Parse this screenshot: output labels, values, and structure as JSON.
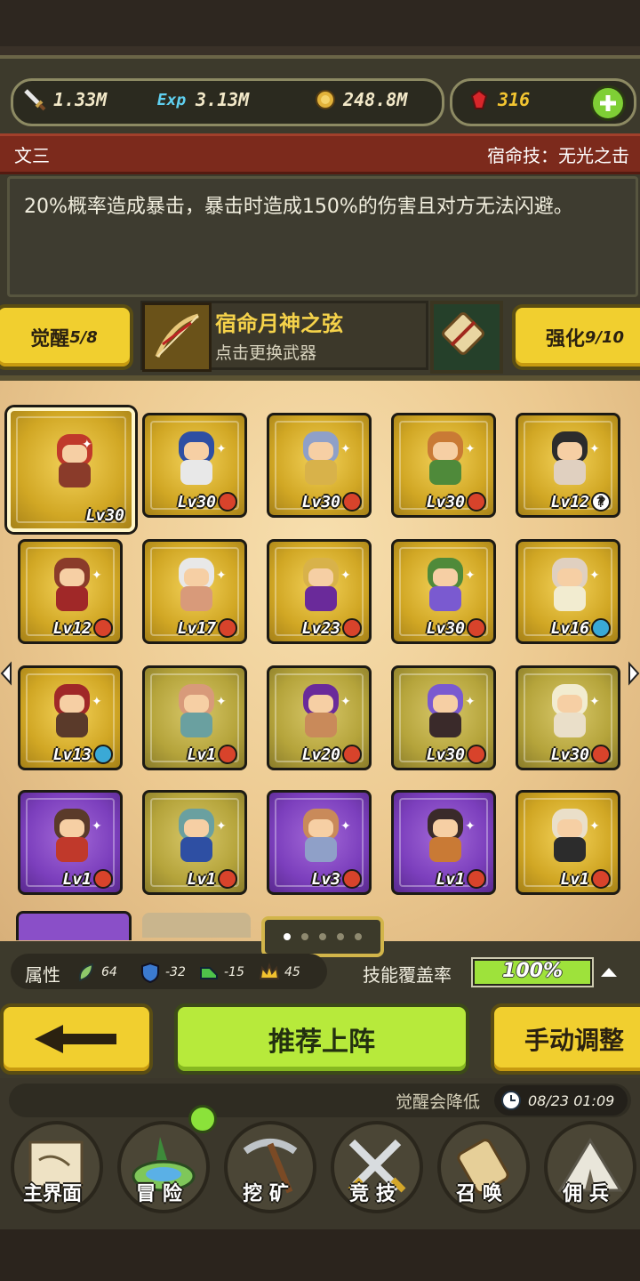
{
  "resources": {
    "attack": "1.33M",
    "exp_label": "Exp",
    "exp": "3.13M",
    "gold": "248.8M",
    "gems": "316"
  },
  "hero": {
    "name": "文三",
    "fate_skill": "宿命技：无光之击",
    "description": "20%概率造成暴击，暴击时造成150%的伤害且对方无法闪避。"
  },
  "awaken": {
    "label": "觉醒",
    "value": "5/8"
  },
  "weapon": {
    "name": "宿命月神之弦",
    "hint": "点击更换武器"
  },
  "enhance": {
    "label": "强化",
    "value": "9/10"
  },
  "cards": [
    {
      "lv": "Lv30",
      "rarity": "gold",
      "badge": "none",
      "selected": true
    },
    {
      "lv": "Lv30",
      "rarity": "gold",
      "badge": "red"
    },
    {
      "lv": "Lv30",
      "rarity": "gold",
      "badge": "red"
    },
    {
      "lv": "Lv30",
      "rarity": "gold",
      "badge": "red"
    },
    {
      "lv": "Lv12",
      "rarity": "gold",
      "badge": "question"
    },
    {
      "lv": "Lv12",
      "rarity": "gold",
      "badge": "red"
    },
    {
      "lv": "Lv17",
      "rarity": "gold",
      "badge": "red"
    },
    {
      "lv": "Lv23",
      "rarity": "gold",
      "badge": "red"
    },
    {
      "lv": "Lv30",
      "rarity": "gold",
      "badge": "red"
    },
    {
      "lv": "Lv16",
      "rarity": "gold",
      "badge": "blue"
    },
    {
      "lv": "Lv13",
      "rarity": "gold",
      "badge": "blue"
    },
    {
      "lv": "Lv1",
      "rarity": "olive",
      "badge": "red"
    },
    {
      "lv": "Lv20",
      "rarity": "olive",
      "badge": "red"
    },
    {
      "lv": "Lv30",
      "rarity": "olive",
      "badge": "red"
    },
    {
      "lv": "Lv30",
      "rarity": "olive",
      "badge": "red"
    },
    {
      "lv": "Lv1",
      "rarity": "purple",
      "badge": "red"
    },
    {
      "lv": "Lv1",
      "rarity": "olive",
      "badge": "red"
    },
    {
      "lv": "Lv3",
      "rarity": "purple",
      "badge": "red"
    },
    {
      "lv": "Lv1",
      "rarity": "purple",
      "badge": "red"
    },
    {
      "lv": "Lv1",
      "rarity": "gold",
      "badge": "red"
    }
  ],
  "pager": {
    "count": 5,
    "active_index": 0
  },
  "attributes": {
    "label": "属性",
    "values": [
      "64",
      "-32",
      "-15",
      "45"
    ]
  },
  "skill_coverage": {
    "label": "技能覆盖率",
    "value": "100%",
    "fraction": 1.0
  },
  "buttons": {
    "recommend": "推荐上阵",
    "manual": "手动调整"
  },
  "notice": {
    "text": "觉醒会降低",
    "time": "08/23 01:09"
  },
  "nav": [
    "主界面",
    "冒 险",
    "挖 矿",
    "竞 技",
    "召 唤",
    "佣 兵"
  ],
  "colors": {
    "accent_yellow": "#f1cf2f",
    "accent_green": "#b7ea3b",
    "banner_red": "#7c2a1c"
  }
}
